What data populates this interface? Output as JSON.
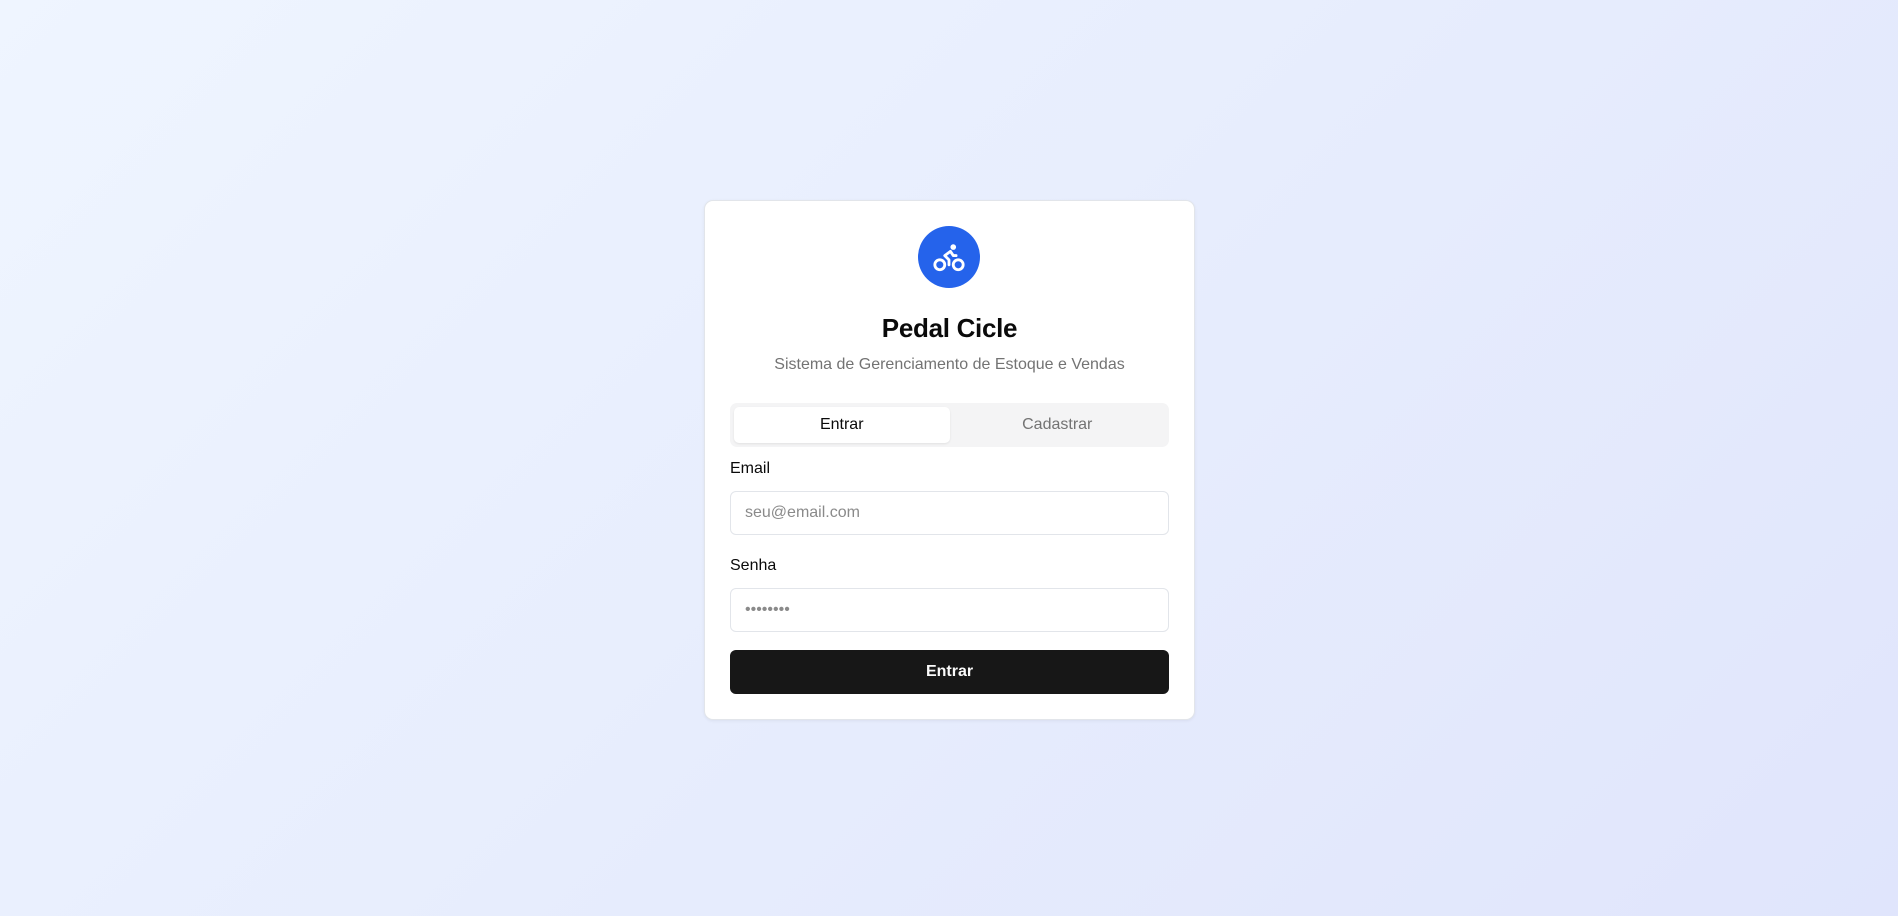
{
  "app": {
    "title": "Pedal Cicle",
    "subtitle": "Sistema de Gerenciamento de Estoque e Vendas",
    "logo_icon": "bike-icon",
    "brand_color": "#2563eb"
  },
  "tabs": [
    {
      "label": "Entrar",
      "active": true
    },
    {
      "label": "Cadastrar",
      "active": false
    }
  ],
  "form": {
    "email": {
      "label": "Email",
      "placeholder": "seu@email.com",
      "value": ""
    },
    "senha": {
      "label": "Senha",
      "placeholder": "••••••••",
      "value": ""
    },
    "submit_label": "Entrar"
  }
}
